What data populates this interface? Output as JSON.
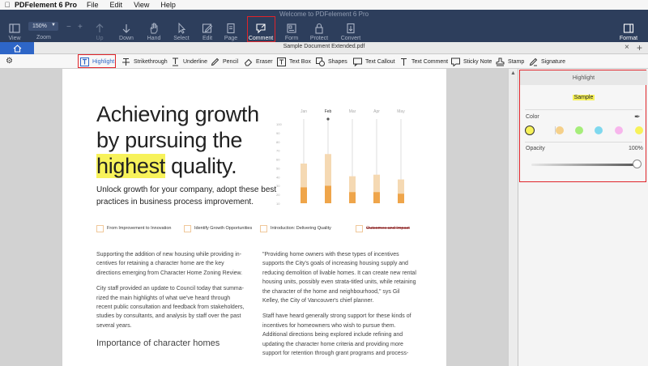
{
  "menubar": {
    "apple": "",
    "app": "PDFelement 6 Pro",
    "items": [
      "File",
      "Edit",
      "View",
      "Help"
    ]
  },
  "window": {
    "title": "Welcome to PDFelement 6 Pro"
  },
  "toolbar": {
    "zoom_value": "150%",
    "zoom_label": "Zoom",
    "zoom_minus": "−",
    "zoom_plus": "+",
    "items": [
      {
        "label": "View",
        "icon": "view-icon"
      },
      {
        "label": "Up",
        "icon": "up-icon"
      },
      {
        "label": "Down",
        "icon": "down-icon"
      },
      {
        "label": "Hand",
        "icon": "hand-icon"
      },
      {
        "label": "Select",
        "icon": "select-icon"
      },
      {
        "label": "Edit",
        "icon": "edit-icon"
      },
      {
        "label": "Page",
        "icon": "page-icon"
      },
      {
        "label": "Comment",
        "icon": "comment-icon"
      },
      {
        "label": "Form",
        "icon": "form-icon"
      },
      {
        "label": "Protect",
        "icon": "protect-icon"
      },
      {
        "label": "Convert",
        "icon": "convert-icon"
      },
      {
        "label": "Format",
        "icon": "format-icon"
      }
    ]
  },
  "tabbar": {
    "doc_title": "Sample Document Extended.pdf",
    "close": "×",
    "add": "+"
  },
  "comment_tools": [
    {
      "label": "Highlight",
      "icon": "highlight-icon"
    },
    {
      "label": "Strikethrough",
      "icon": "strikethrough-icon"
    },
    {
      "label": "Underline",
      "icon": "underline-icon"
    },
    {
      "label": "Pencil",
      "icon": "pencil-icon"
    },
    {
      "label": "Eraser",
      "icon": "eraser-icon"
    },
    {
      "label": "Text Box",
      "icon": "textbox-icon"
    },
    {
      "label": "Shapes",
      "icon": "shapes-icon"
    },
    {
      "label": "Text Callout",
      "icon": "text-callout-icon"
    },
    {
      "label": "Text Comment",
      "icon": "text-comment-icon"
    },
    {
      "label": "Sticky Note",
      "icon": "sticky-note-icon"
    },
    {
      "label": "Stamp",
      "icon": "stamp-icon"
    },
    {
      "label": "Signature",
      "icon": "signature-icon"
    }
  ],
  "document": {
    "headline_1": "Achieving growth",
    "headline_2": "by pursuing the",
    "headline_3_hl": "highest",
    "headline_3_rest": " quality.",
    "subhead": "Unlock growth for your company, adopt these best practices in business process improvement.",
    "legend": [
      "From Improvement to Innovation",
      "Identify Growth Opportunities",
      "Introduction: Delivering Quality",
      "Outcomes and Impact"
    ],
    "left_col": [
      "Supporting the addition of new housing while providing in-centives for retaining a character home are the key directions emerging from Character Home Zoning Review.",
      "City staff provided an update to Council today that summa-rized the main highlights of what we've heard through recent public consultation and feedback from stakeholders, studies by consultants, and analysis by staff over the past several years."
    ],
    "left_heading": "Importance of character homes",
    "right_col": [
      "\"Providing home owners with these types of incentives supports the City's goals of increasing housing supply and reducing demolition of livable homes.  It can create new rental housing units, possibly even strata-titled units, while retaining the character of the home and neighbourhood,\" sys Gil Kelley, the City of Vancouver's chief planner.",
      "Staff have heard generally strong support for these kinds of incentives for homeowners who wish to pursue them. Additional directions being explored include refining and updating the character home criteria and providing more support for retention through grant programs and process-"
    ]
  },
  "chart_data": {
    "type": "bar",
    "categories": [
      "Jan",
      "Feb",
      "Mar",
      "Apr",
      "May"
    ],
    "series": [
      {
        "values": [
          50,
          62,
          34,
          36,
          30
        ]
      },
      {
        "values": [
          20,
          22,
          14,
          14,
          12
        ]
      }
    ],
    "yticks": [
      "100",
      "90",
      "80",
      "70",
      "60",
      "50",
      "40",
      "30",
      "20",
      "10"
    ],
    "ylim": [
      0,
      100
    ],
    "colors": {
      "light": "#f5d9b3",
      "dark": "#efa54a"
    }
  },
  "panel": {
    "title": "Highlight",
    "sample": "Sample",
    "color_label": "Color",
    "swatches": [
      "#f7f25a",
      "#f5d08a",
      "#a6ed7a",
      "#7fd8ee",
      "#f7b6ec",
      "#f7f25a"
    ],
    "opacity_label": "Opacity",
    "opacity_value": "100%",
    "opacity": 1.0
  }
}
